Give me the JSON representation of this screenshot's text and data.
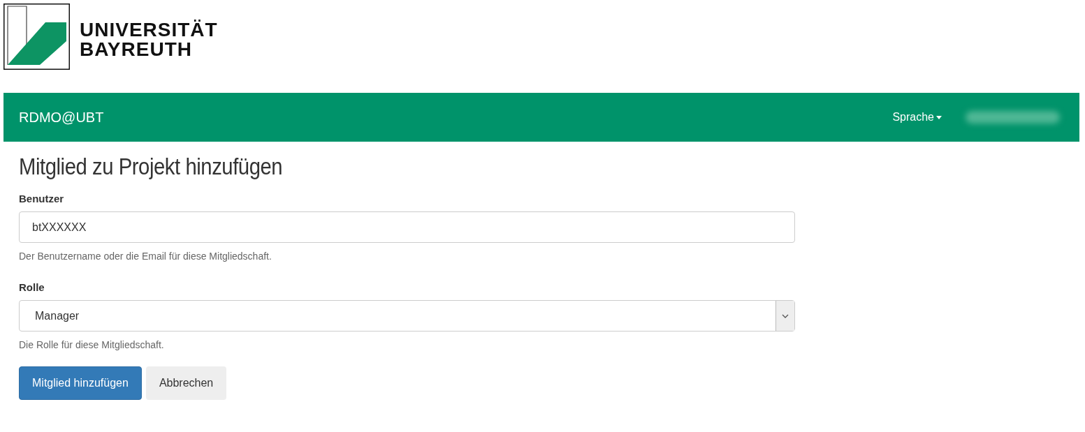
{
  "logo": {
    "line_1": "UNIVERSITÄT",
    "line_2": "BAYREUTH"
  },
  "navbar": {
    "brand": "RDMO@UBT",
    "language_menu": "Sprache"
  },
  "page_title": "Mitglied zu Projekt hinzufügen",
  "fields": [
    {
      "kind": "text",
      "label": "Benutzer",
      "value": "btXXXXXX",
      "help": "Der Benutzername oder die Email für diese Mitgliedschaft."
    },
    {
      "kind": "select",
      "label": "Rolle",
      "value": "Manager",
      "help": "Die Rolle für diese Mitgliedschaft."
    }
  ],
  "buttons": [
    {
      "label": "Mitglied hinzufügen",
      "kind": "primary"
    },
    {
      "label": "Abbrechen",
      "kind": "default"
    }
  ]
}
